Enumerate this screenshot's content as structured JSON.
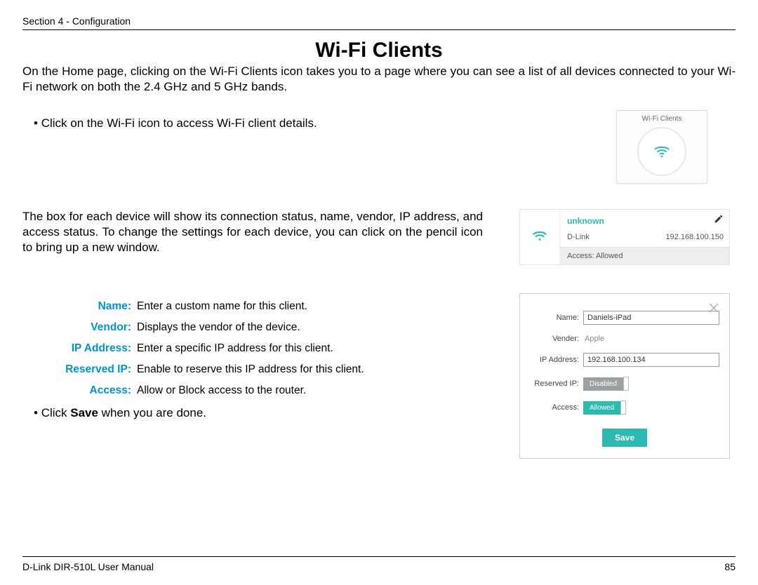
{
  "header": {
    "section": "Section 4 - Configuration"
  },
  "title": "Wi-Fi Clients",
  "intro": "On the Home page, clicking on the Wi-Fi Clients icon takes you to a page where you can see a list of all devices connected to your Wi-Fi network on both the 2.4 GHz and 5 GHz bands.",
  "bullet1": "Click on the Wi-Fi icon to access Wi-Fi client details.",
  "widget": {
    "title": "Wi-Fi Clients"
  },
  "para2": "The box for each device will show its connection status, name, vendor, IP address, and access status. To change the settings for each device, you can click on the pencil icon to bring up a new window.",
  "device": {
    "name": "unknown",
    "vendor": "D-Link",
    "ip": "192.168.100.150",
    "access": "Access: Allowed"
  },
  "defs": {
    "name_label": "Name:",
    "name_text": "Enter a custom name for this client.",
    "vendor_label": "Vendor:",
    "vendor_text": "Displays the vendor of the device.",
    "ip_label": "IP Address:",
    "ip_text": "Enter a specific IP address for this client.",
    "reserved_label": "Reserved IP:",
    "reserved_text": "Enable to reserve this IP address for this client.",
    "access_label": "Access:",
    "access_text": "Allow or Block access to the router."
  },
  "bullet2_prefix": "Click ",
  "bullet2_bold": "Save",
  "bullet2_suffix": " when you are done.",
  "dialog": {
    "name_label": "Name:",
    "name_value": "Daniels-iPad",
    "vendor_label": "Vender:",
    "vendor_value": "Apple",
    "ip_label": "IP Address:",
    "ip_value": "192.168.100.134",
    "reserved_label": "Reserved IP:",
    "reserved_value": "Disabled",
    "access_label": "Access:",
    "access_value": "Allowed",
    "save": "Save"
  },
  "footer": {
    "left": "D-Link DIR-510L User Manual",
    "right": "85"
  },
  "colors": {
    "accent": "#2bb9b0",
    "label_blue": "#0093d0"
  }
}
